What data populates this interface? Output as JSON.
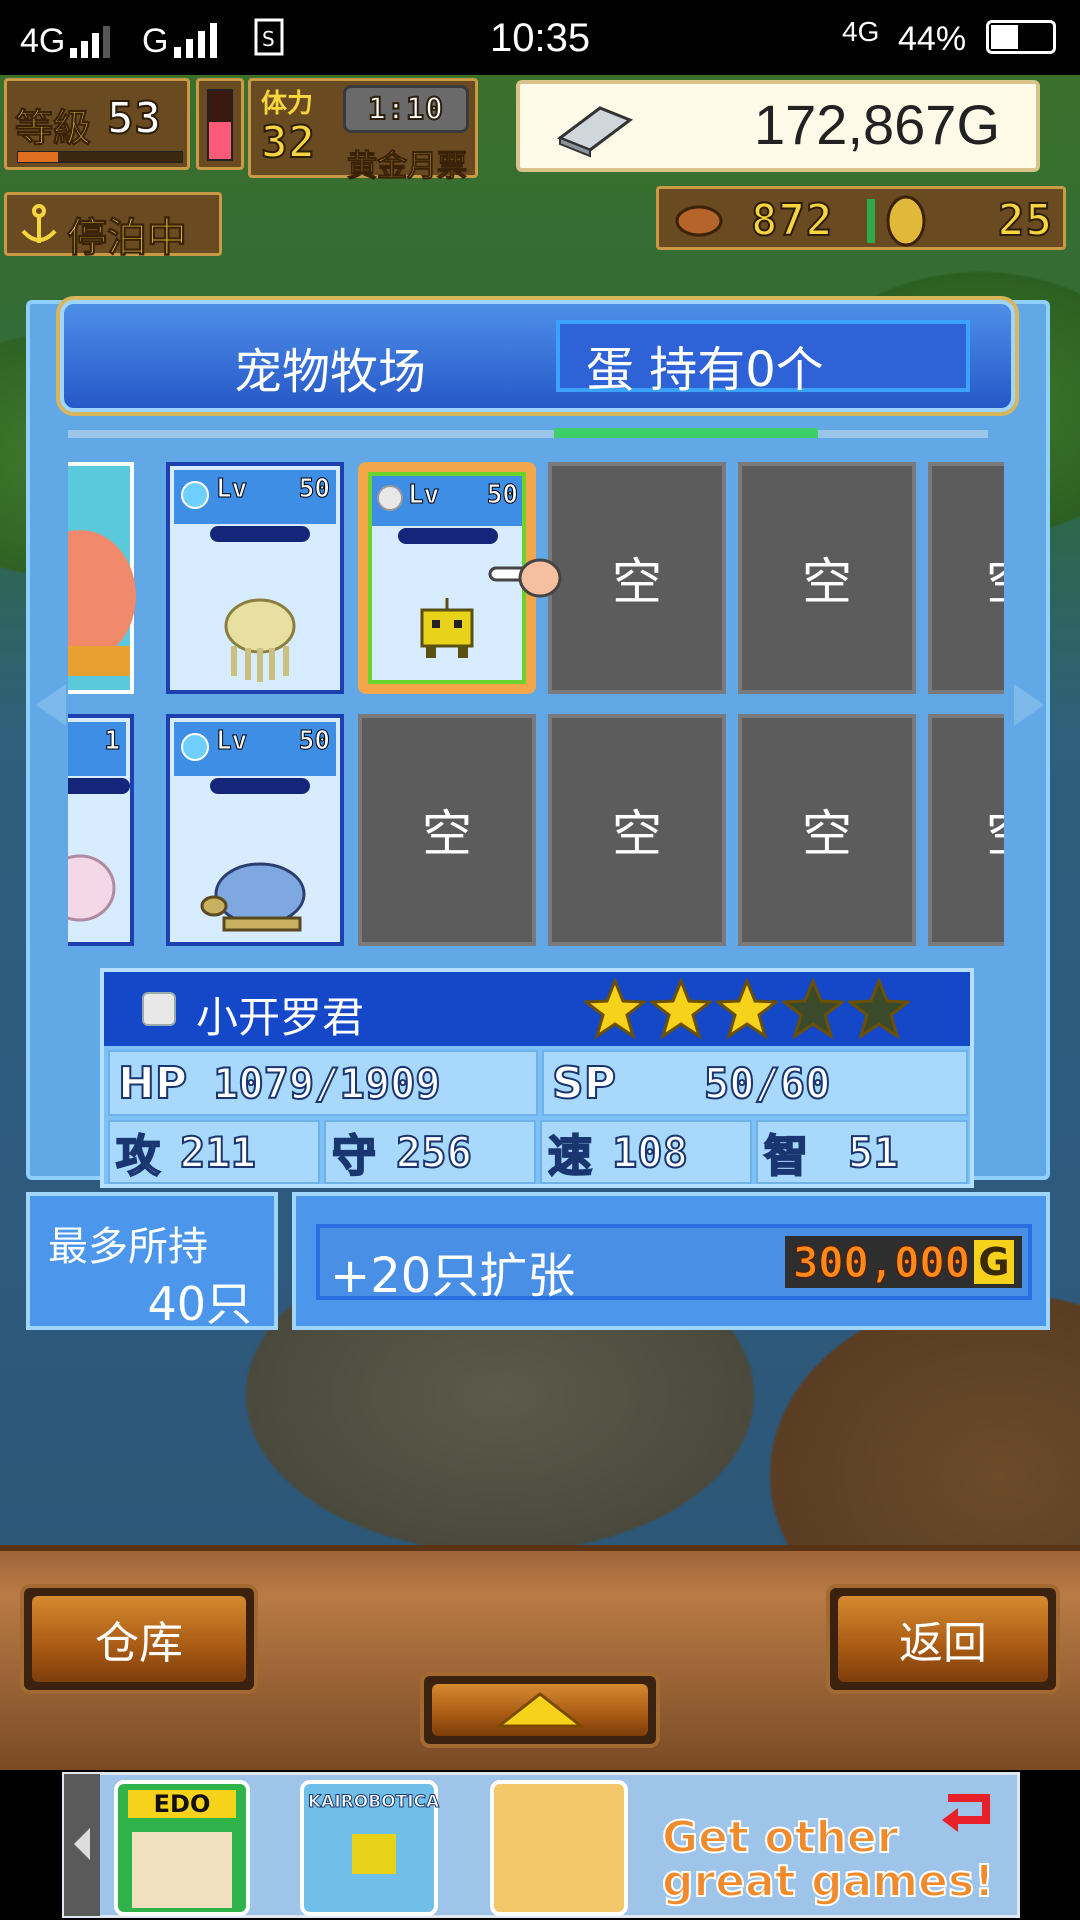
{
  "status_bar": {
    "network_left": "4G",
    "network_g": "G",
    "time": "10:35",
    "network_right": "4G",
    "battery": "44%"
  },
  "hud": {
    "level_label": "等級",
    "level_value": "53",
    "stamina_label": "体力",
    "stamina_value": "32",
    "timer": "1:10",
    "gold_pass": "黄金月票",
    "gold_amount": "172,867G",
    "docked_label": "停泊中",
    "food_count": "872",
    "medal_count": "25"
  },
  "panel": {
    "title": "宠物牧场",
    "egg_label": "蛋 持有0个"
  },
  "slots": {
    "row1": [
      {
        "kind": "partial-egg"
      },
      {
        "kind": "pet",
        "lv": "Lv",
        "level": "50",
        "sprite": "jellyfish"
      },
      {
        "kind": "pet-selected",
        "lv": "Lv",
        "level": "50",
        "sprite": "yellow-robot"
      },
      {
        "kind": "empty",
        "label": "空"
      },
      {
        "kind": "empty",
        "label": "空"
      },
      {
        "kind": "empty-partial",
        "label": "空"
      }
    ],
    "row2": [
      {
        "kind": "partial-pet",
        "level": "1"
      },
      {
        "kind": "pet",
        "lv": "Lv",
        "level": "50",
        "sprite": "blue-turtle"
      },
      {
        "kind": "empty",
        "label": "空"
      },
      {
        "kind": "empty",
        "label": "空"
      },
      {
        "kind": "empty",
        "label": "空"
      },
      {
        "kind": "empty-partial",
        "label": "空"
      }
    ]
  },
  "selected_pet": {
    "name": "小开罗君",
    "stars_filled": 3,
    "stars_total": 5,
    "hp_label": "HP",
    "hp_value": "1079/1909",
    "sp_label": "SP",
    "sp_value": "50/60",
    "atk_label": "攻",
    "atk_value": "211",
    "def_label": "守",
    "def_value": "256",
    "spd_label": "速",
    "spd_value": "108",
    "int_label": "智",
    "int_value": "51"
  },
  "capacity": {
    "label": "最多所持",
    "value": "40只"
  },
  "expand": {
    "label": "+20只扩张",
    "price": "300,000",
    "currency": "G"
  },
  "buttons": {
    "warehouse": "仓库",
    "back": "返回"
  },
  "ad": {
    "game1": "EDO",
    "game2": "KAIROBOTICA",
    "promo_line1": "Get other",
    "promo_line2": "great games!"
  },
  "colors": {
    "panel_blue": "#62a8e6",
    "title_blue": "#2758c8",
    "gold_text": "#f5d13a",
    "empty_slot": "#5c5c5c"
  }
}
